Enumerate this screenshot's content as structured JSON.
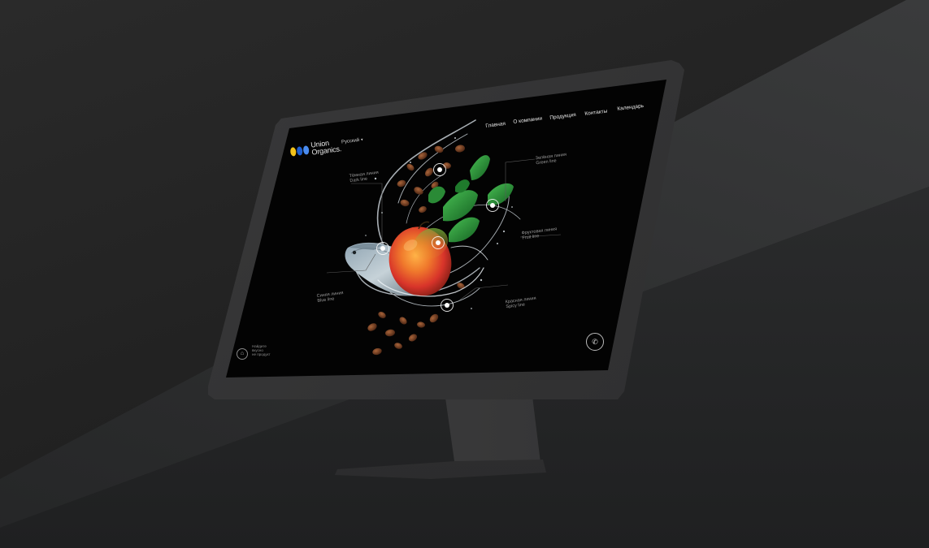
{
  "site": {
    "logo": {
      "line1": "Union",
      "line2": "Organics.",
      "colors": [
        "#f2c21a",
        "#1e5fd0",
        "#4a8cf0"
      ]
    },
    "language": {
      "selected": "Русский",
      "caret": "▾"
    },
    "nav": [
      {
        "label": "Главная"
      },
      {
        "label": "О компании"
      },
      {
        "label": "Продукция"
      },
      {
        "label": "Контакты"
      },
      {
        "label": "Календарь"
      }
    ]
  },
  "product_lines": [
    {
      "ru": "Тёмная линия",
      "en": "Dark line"
    },
    {
      "ru": "Зелёная линия",
      "en": "Green line"
    },
    {
      "ru": "Фруктовая линия",
      "en": "Fruit line"
    },
    {
      "ru": "Синяя линия",
      "en": "Blue line"
    },
    {
      "ru": "Красная линия",
      "en": "Spicy line"
    }
  ],
  "footer": {
    "home_text": "Найдите\nвкусно\nне продукт",
    "home_icon": "home-icon",
    "phone_icon": "phone-icon"
  },
  "colors": {
    "screen_bg": "#030303",
    "accent_mango": "#e8502a",
    "leaf_green": "#2f9a3c"
  }
}
